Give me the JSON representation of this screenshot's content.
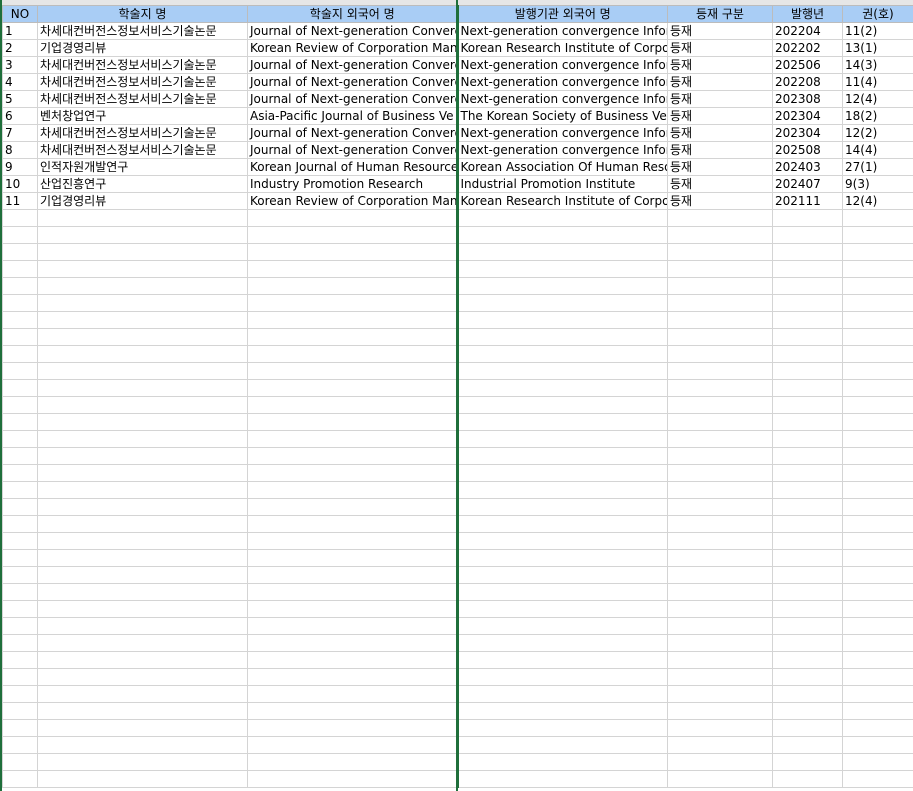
{
  "columns": [
    "NO",
    "학술지 명",
    "학술지 외국어 명",
    "발행기관 외국어 명",
    "등재 구분",
    "발행년",
    "권(호)"
  ],
  "rows": [
    {
      "no": "1",
      "journal": "차세대컨버전스정보서비스기술논문",
      "journal_en": "Journal of Next-generation Converge",
      "publisher_en": "Next-generation convergence Inform",
      "status": "등재",
      "year": "202204",
      "vol": "11(2)"
    },
    {
      "no": "2",
      "journal": "기업경영리뷰",
      "journal_en": "Korean Review of Corporation Mana",
      "publisher_en": "Korean Research Institute of Corpor",
      "status": "등재",
      "year": "202202",
      "vol": "13(1)"
    },
    {
      "no": "3",
      "journal": "차세대컨버전스정보서비스기술논문",
      "journal_en": "Journal of Next-generation Converge",
      "publisher_en": "Next-generation convergence Inform",
      "status": "등재",
      "year": "202506",
      "vol": "14(3)"
    },
    {
      "no": "4",
      "journal": "차세대컨버전스정보서비스기술논문",
      "journal_en": "Journal of Next-generation Converge",
      "publisher_en": "Next-generation convergence Inform",
      "status": "등재",
      "year": "202208",
      "vol": "11(4)"
    },
    {
      "no": "5",
      "journal": "차세대컨버전스정보서비스기술논문",
      "journal_en": "Journal of Next-generation Converge",
      "publisher_en": "Next-generation convergence Inform",
      "status": "등재",
      "year": "202308",
      "vol": "12(4)"
    },
    {
      "no": "6",
      "journal": "벤처창업연구",
      "journal_en": "Asia-Pacific Journal of Business Ve",
      "publisher_en": "The Korean Society of Business Ve",
      "status": "등재",
      "year": "202304",
      "vol": "18(2)"
    },
    {
      "no": "7",
      "journal": "차세대컨버전스정보서비스기술논문",
      "journal_en": "Journal of Next-generation Converge",
      "publisher_en": "Next-generation convergence Inform",
      "status": "등재",
      "year": "202304",
      "vol": "12(2)"
    },
    {
      "no": "8",
      "journal": "차세대컨버전스정보서비스기술논문",
      "journal_en": "Journal of Next-generation Converge",
      "publisher_en": "Next-generation convergence Inform",
      "status": "등재",
      "year": "202508",
      "vol": "14(4)"
    },
    {
      "no": "9",
      "journal": "인적자원개발연구",
      "journal_en": "Korean Journal of Human Resources",
      "publisher_en": "Korean Association Of Human Reso",
      "status": "등재",
      "year": "202403",
      "vol": "27(1)"
    },
    {
      "no": "10",
      "journal": "산업진흥연구",
      "journal_en": "Industry Promotion Research",
      "publisher_en": "Industrial Promotion Institute",
      "status": "등재",
      "year": "202407",
      "vol": "9(3)"
    },
    {
      "no": "11",
      "journal": "기업경영리뷰",
      "journal_en": "Korean Review of Corporation Mana",
      "publisher_en": "Korean Research Institute of Corpor",
      "status": "등재",
      "year": "202111",
      "vol": "12(4)"
    }
  ],
  "empty_row_count": 34,
  "colors": {
    "header_fill": "#a9cdf5",
    "gridline": "#d4d4d4",
    "divider": "#1f6f3b"
  }
}
